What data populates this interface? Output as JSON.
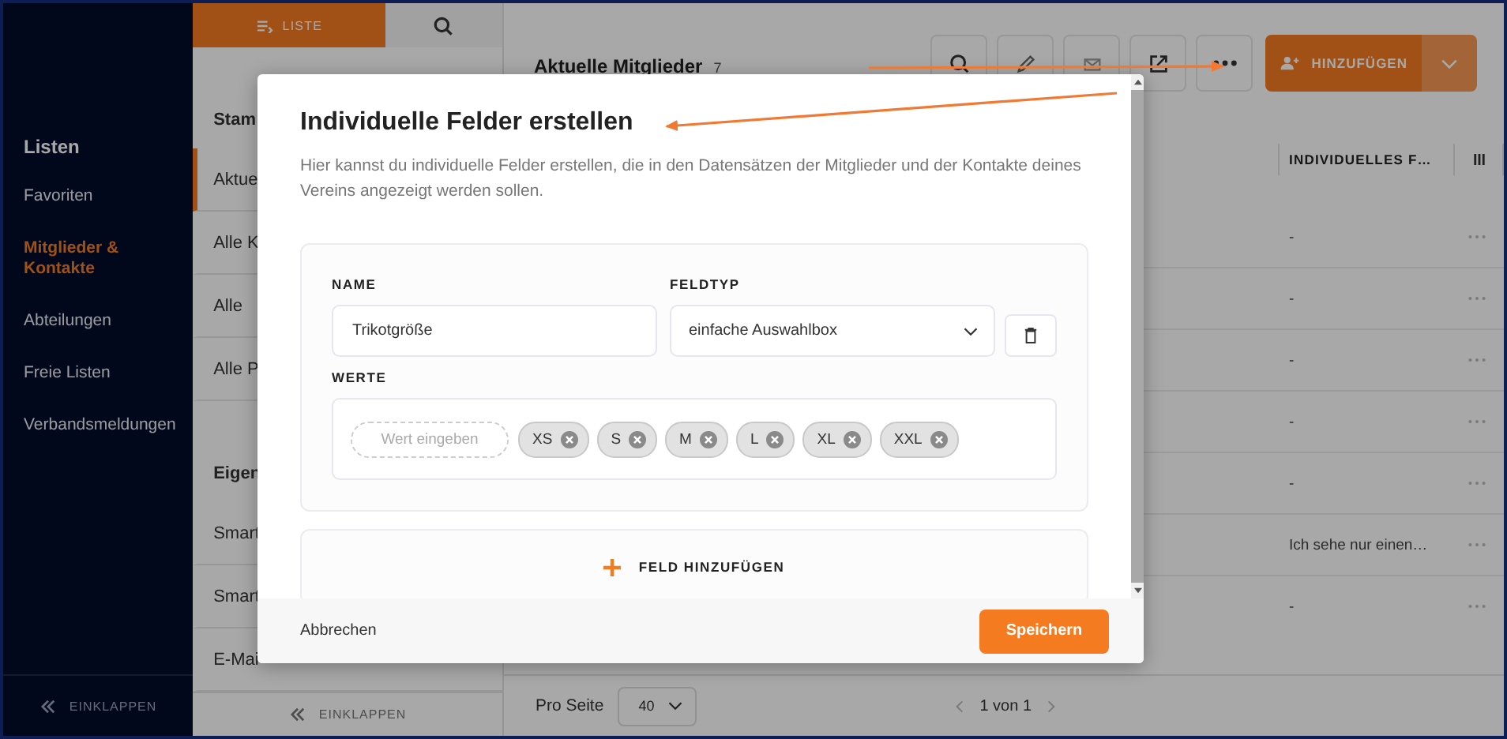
{
  "sidebar": {
    "title": "Listen",
    "items": [
      {
        "label": "Favoriten",
        "selected": false
      },
      {
        "label": "Mitglieder & Kontakte",
        "selected": true
      },
      {
        "label": "Abteilungen",
        "selected": false
      },
      {
        "label": "Freie Listen",
        "selected": false
      },
      {
        "label": "Verbandsmeldungen",
        "selected": false
      }
    ],
    "collapse": "EINKLAPPEN"
  },
  "list_panel": {
    "tabs": [
      {
        "kind": "list",
        "label": "LISTE",
        "selected": true
      },
      {
        "kind": "search",
        "selected": false
      }
    ],
    "sections": [
      {
        "title": "Stam",
        "items": [
          {
            "label": "Aktue",
            "selected": true
          },
          {
            "label": "Alle K",
            "selected": false
          },
          {
            "label": "Alle",
            "selected": false
          },
          {
            "label": "Alle P",
            "selected": false
          }
        ]
      },
      {
        "title": "Eigen",
        "items": [
          {
            "label": "Smart",
            "selected": false
          },
          {
            "label": "Smart",
            "selected": false
          },
          {
            "label": "E-Mai",
            "selected": false
          }
        ]
      }
    ],
    "collapse": "EINKLAPPEN"
  },
  "main": {
    "title": "Aktuelle Mitglieder",
    "count": "7",
    "add_button": "HINZUFÜGEN",
    "table": {
      "columns": [
        "INDIVIDUELLES F…"
      ],
      "rows": [
        {
          "cell": "-"
        },
        {
          "cell": "-"
        },
        {
          "cell": "-"
        },
        {
          "cell": "-"
        },
        {
          "cell": "-"
        },
        {
          "cell": "Ich sehe nur einen…"
        },
        {
          "cell": "-"
        }
      ]
    },
    "pagination": {
      "per_page_label": "Pro Seite",
      "per_page": "40",
      "page": "1 von 1"
    }
  },
  "dialog": {
    "title": "Individuelle Felder erstellen",
    "description": "Hier kannst du individuelle Felder erstellen, die in den Datensätzen der Mitglieder und der Kontakte deines Vereins angezeigt werden sollen.",
    "fields": [
      {
        "name_label": "NAME",
        "name_value": "Trikotgröße",
        "type_label": "FELDTYP",
        "type_value": "einfache Auswahlbox",
        "values_label": "WERTE",
        "value_placeholder": "Wert eingeben",
        "values": [
          "XS",
          "S",
          "M",
          "L",
          "XL",
          "XXL"
        ]
      }
    ],
    "add_field": "FELD HINZUFÜGEN",
    "cancel": "Abbrechen",
    "save": "Speichern"
  }
}
